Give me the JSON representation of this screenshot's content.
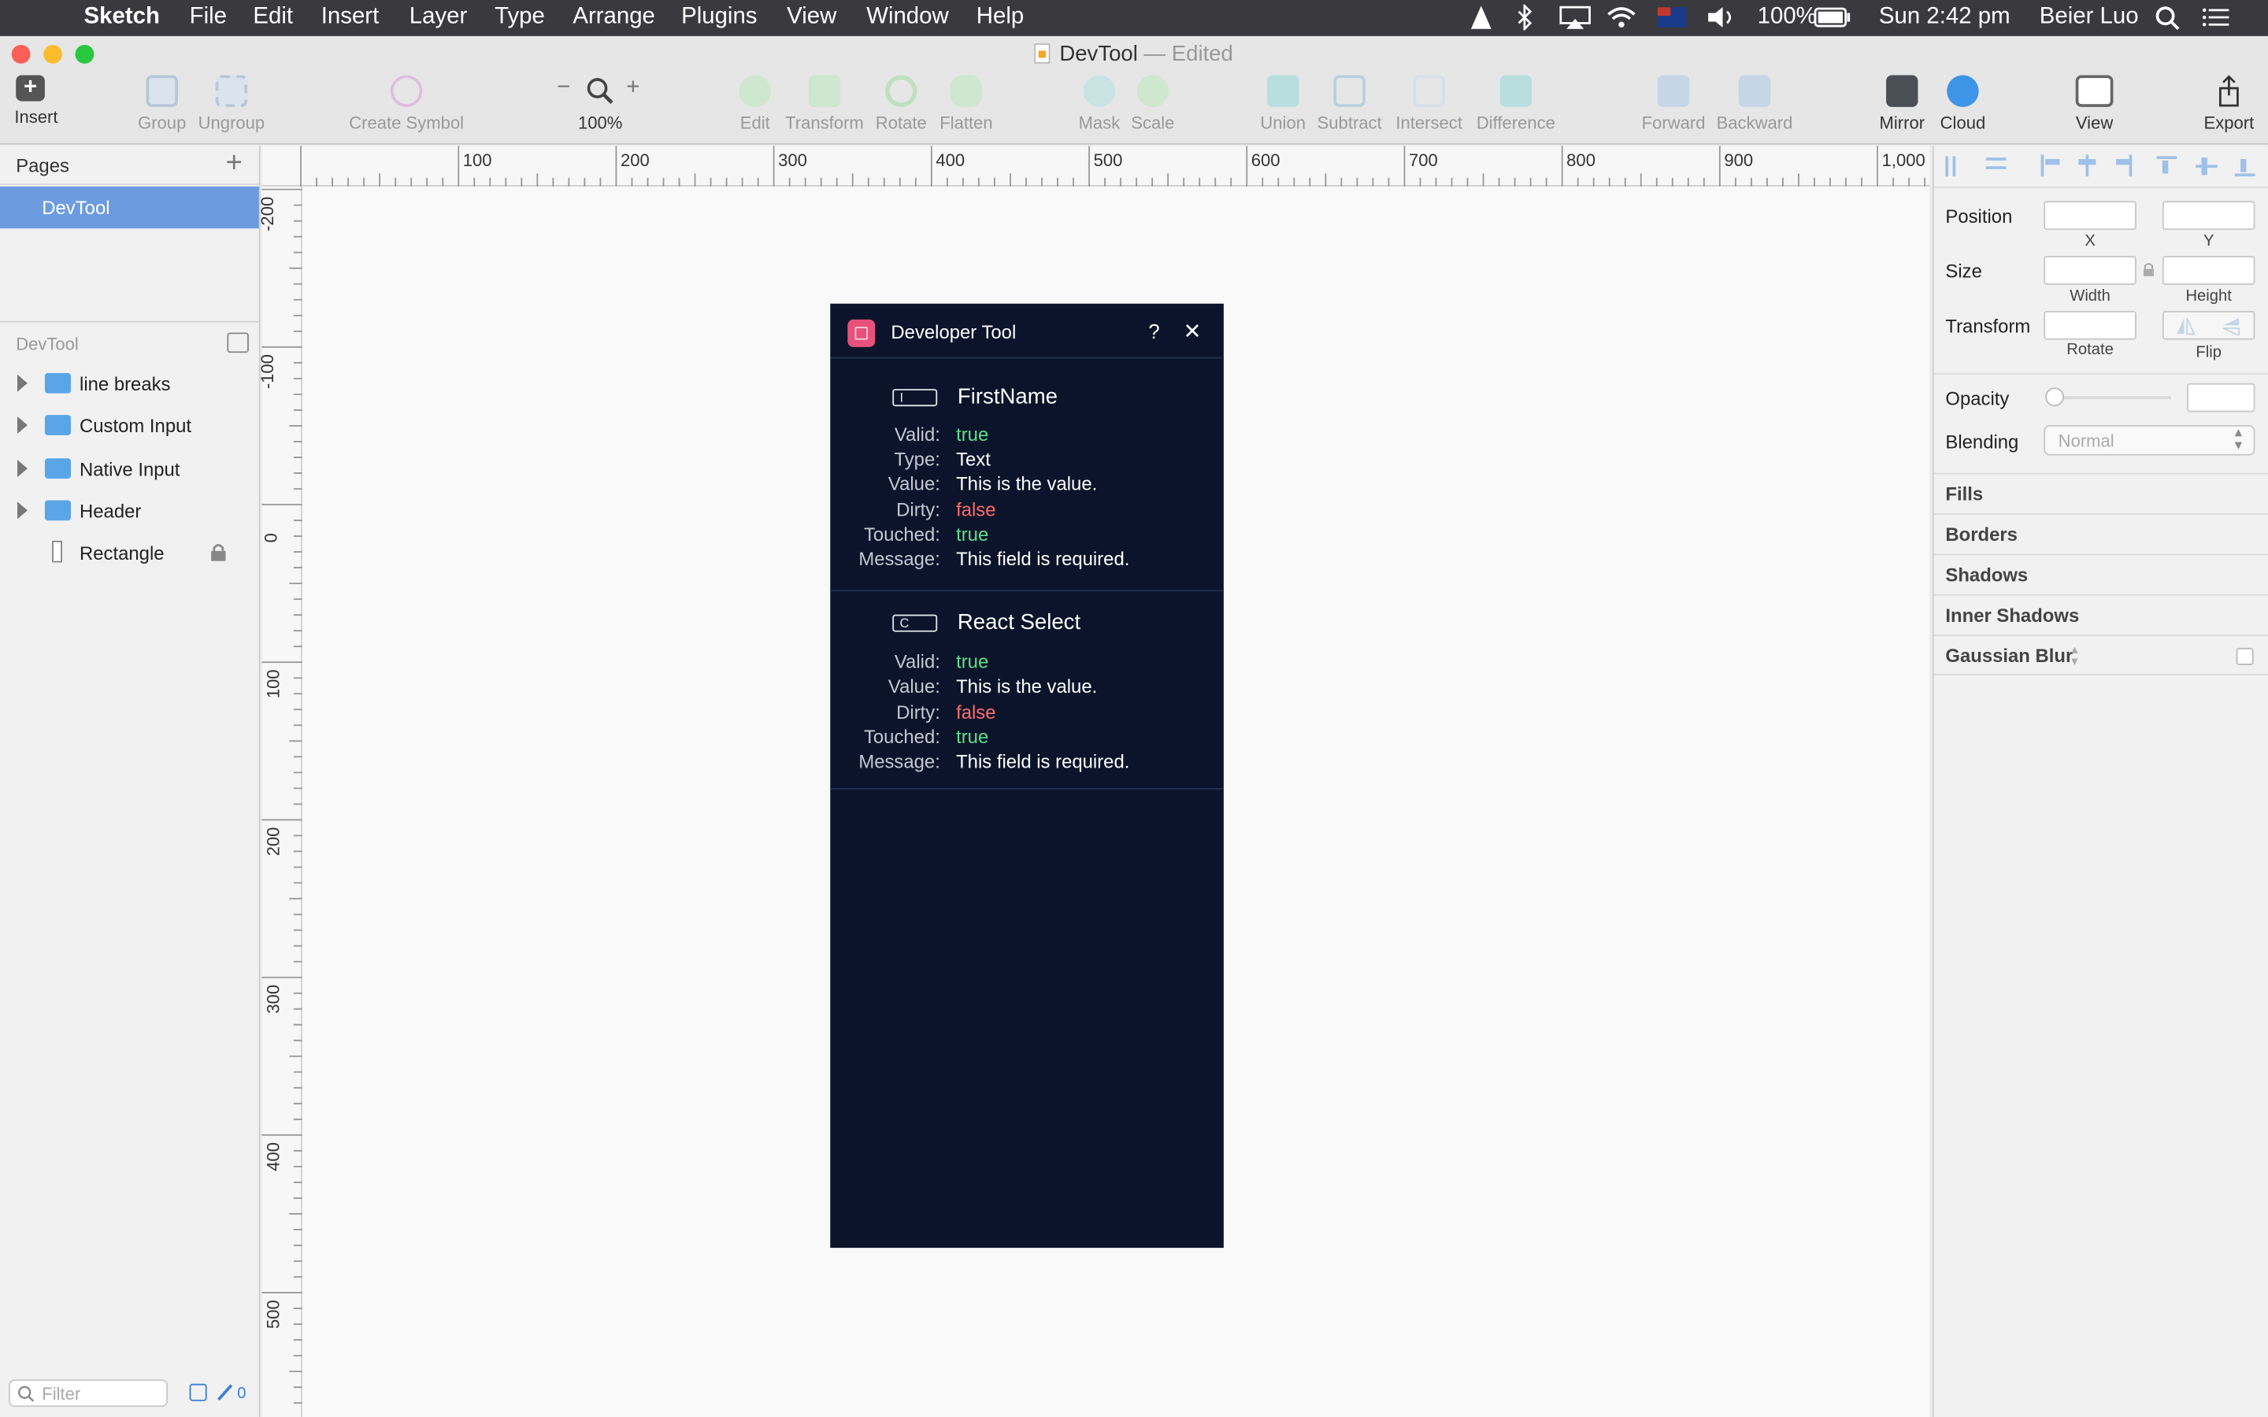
{
  "menubar": {
    "app": "Sketch",
    "items": [
      "File",
      "Edit",
      "Insert",
      "Layer",
      "Type",
      "Arrange",
      "Plugins",
      "View",
      "Window",
      "Help"
    ],
    "battery": "100%",
    "clock": "Sun 2:42 pm",
    "user": "Beier Luo"
  },
  "window": {
    "title": "DevTool",
    "edited": "— Edited"
  },
  "toolbar": {
    "insert": "Insert",
    "group": "Group",
    "ungroup": "Ungroup",
    "create_symbol": "Create Symbol",
    "zoom": "100%",
    "edit": "Edit",
    "transform": "Transform",
    "rotate": "Rotate",
    "flatten": "Flatten",
    "mask": "Mask",
    "scale": "Scale",
    "union": "Union",
    "subtract": "Subtract",
    "intersect": "Intersect",
    "difference": "Difference",
    "forward": "Forward",
    "backward": "Backward",
    "mirror": "Mirror",
    "cloud": "Cloud",
    "view": "View",
    "export": "Export"
  },
  "pages": {
    "header": "Pages",
    "selected": "DevTool"
  },
  "layers": {
    "header": "DevTool",
    "items": [
      {
        "label": "line breaks"
      },
      {
        "label": "Custom Input"
      },
      {
        "label": "Native Input"
      },
      {
        "label": "Header"
      },
      {
        "label": "Rectangle"
      }
    ],
    "filter_placeholder": "Filter",
    "count": "0"
  },
  "rulers": {
    "h": [
      "100",
      "200",
      "300",
      "400",
      "500",
      "600",
      "700",
      "800",
      "900",
      "1,000"
    ],
    "v": [
      "-200",
      "-100",
      "0",
      "100",
      "200",
      "300",
      "400",
      "500"
    ]
  },
  "devtool": {
    "title": "Developer Tool",
    "help": "?",
    "close": "✕",
    "fields": [
      {
        "badge": "I",
        "name": "FirstName",
        "rows": [
          {
            "k": "Valid:",
            "v": "true",
            "color": "green"
          },
          {
            "k": "Type:",
            "v": "Text",
            "color": "white"
          },
          {
            "k": "Value:",
            "v": "This is the value.",
            "color": "white"
          },
          {
            "k": "Dirty:",
            "v": "false",
            "color": "red"
          },
          {
            "k": "Touched:",
            "v": "true",
            "color": "green"
          },
          {
            "k": "Message:",
            "v": "This field is required.",
            "color": "white"
          }
        ]
      },
      {
        "badge": "C",
        "name": "React Select",
        "rows": [
          {
            "k": "Valid:",
            "v": "true",
            "color": "green"
          },
          {
            "k": "Value:",
            "v": "This is the value.",
            "color": "white"
          },
          {
            "k": "Dirty:",
            "v": "false",
            "color": "red"
          },
          {
            "k": "Touched:",
            "v": "true",
            "color": "green"
          },
          {
            "k": "Message:",
            "v": "This field is required.",
            "color": "white"
          }
        ]
      }
    ]
  },
  "inspector": {
    "position": "Position",
    "x": "X",
    "y": "Y",
    "size": "Size",
    "width": "Width",
    "height": "Height",
    "transform": "Transform",
    "rotate": "Rotate",
    "flip": "Flip",
    "opacity": "Opacity",
    "blending": "Blending",
    "blending_value": "Normal",
    "sections": [
      "Fills",
      "Borders",
      "Shadows",
      "Inner Shadows",
      "Gaussian Blur"
    ]
  }
}
